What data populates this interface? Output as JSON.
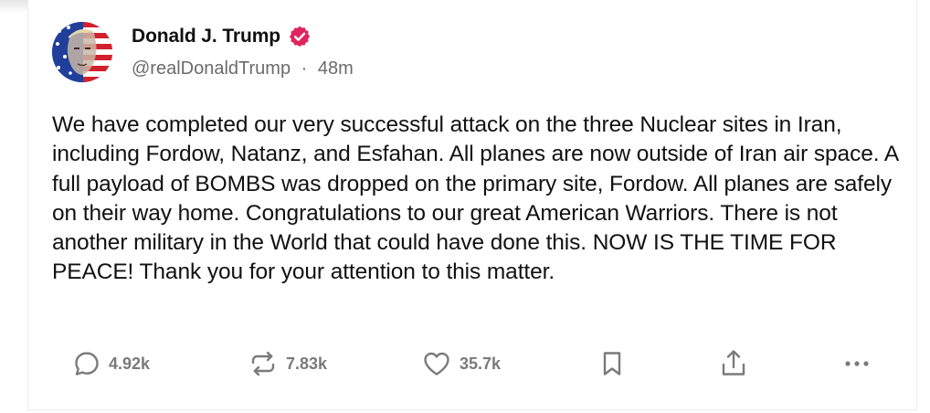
{
  "post": {
    "author_name": "Donald J. Trump",
    "handle": "@realDonaldTrump",
    "separator": "·",
    "timestamp": "48m",
    "verified_color": "#e0245e",
    "text": "We have completed our very successful attack on the three Nuclear sites in Iran, including Fordow, Natanz, and Esfahan. All planes are now outside of Iran air space. A full payload of BOMBS was dropped on the primary site, Fordow. All planes are safely on their way home. Congratulations to our great American Warriors. There is not another military in the World that could have done this. NOW IS THE TIME FOR PEACE! Thank you for your attention to this matter."
  },
  "actions": {
    "replies": {
      "icon": "reply-icon",
      "count": "4.92k"
    },
    "reposts": {
      "icon": "repost-icon",
      "count": "7.83k"
    },
    "likes": {
      "icon": "heart-icon",
      "count": "35.7k"
    },
    "bookmark": {
      "icon": "bookmark-icon"
    },
    "share": {
      "icon": "share-icon"
    },
    "more": {
      "icon": "more-icon"
    }
  }
}
